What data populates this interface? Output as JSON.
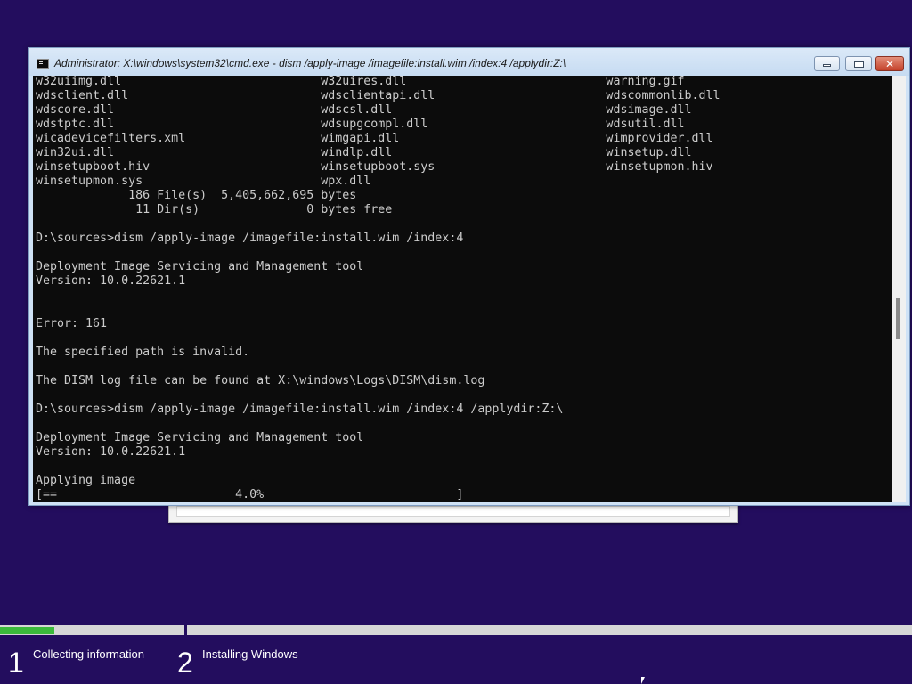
{
  "window": {
    "title": "Administrator: X:\\windows\\system32\\cmd.exe - dism  /apply-image /imagefile:install.wim /index:4 /applydir:Z:\\",
    "close_glyph": "✕"
  },
  "console": {
    "lines": [
      "w32uiimg.dll                            w32uires.dll                            warning.gif",
      "wdsclient.dll                           wdsclientapi.dll                        wdscommonlib.dll",
      "wdscore.dll                             wdscsl.dll                              wdsimage.dll",
      "wdstptc.dll                             wdsupgcompl.dll                         wdsutil.dll",
      "wicadevicefilters.xml                   wimgapi.dll                             wimprovider.dll",
      "win32ui.dll                             windlp.dll                              winsetup.dll",
      "winsetupboot.hiv                        winsetupboot.sys                        winsetupmon.hiv",
      "winsetupmon.sys                         wpx.dll",
      "             186 File(s)  5,405,662,695 bytes",
      "              11 Dir(s)               0 bytes free",
      "",
      "D:\\sources>dism /apply-image /imagefile:install.wim /index:4",
      "",
      "Deployment Image Servicing and Management tool",
      "Version: 10.0.22621.1",
      "",
      "",
      "Error: 161",
      "",
      "The specified path is invalid.",
      "",
      "The DISM log file can be found at X:\\windows\\Logs\\DISM\\dism.log",
      "",
      "D:\\sources>dism /apply-image /imagefile:install.wim /index:4 /applydir:Z:\\",
      "",
      "Deployment Image Servicing and Management tool",
      "Version: 10.0.22621.1",
      "",
      "Applying image",
      "[==                         4.0%                           ]"
    ]
  },
  "setup": {
    "progress_fraction": 0.06,
    "steps": [
      {
        "number": "1",
        "label": "Collecting information"
      },
      {
        "number": "2",
        "label": "Installing Windows"
      }
    ]
  }
}
